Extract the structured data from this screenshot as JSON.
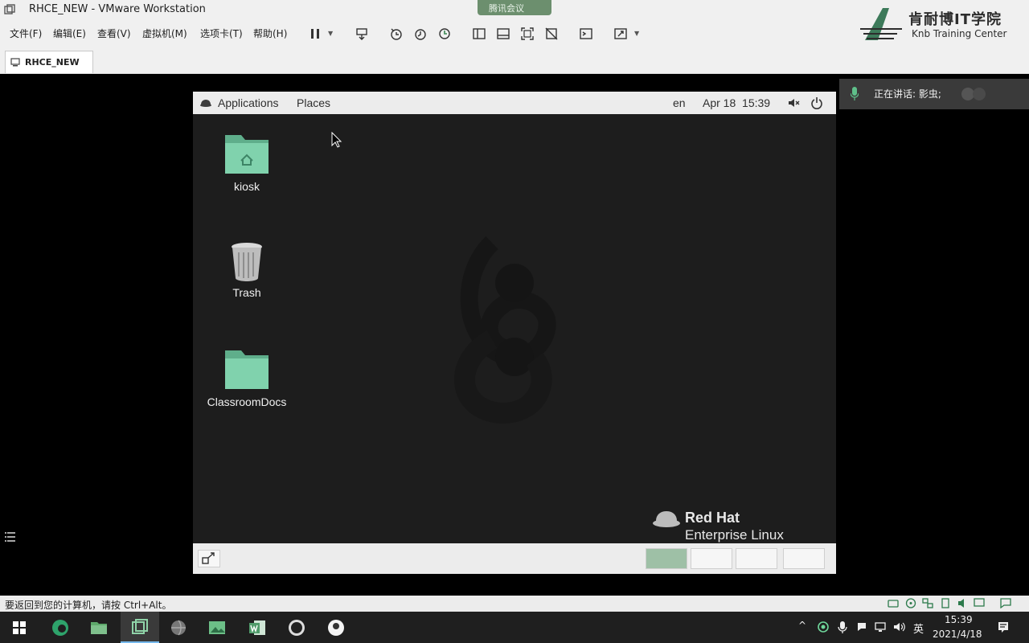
{
  "window": {
    "title": "RHCE_NEW - VMware Workstation"
  },
  "menu": {
    "items": [
      "文件(F)",
      "编辑(E)",
      "查看(V)",
      "虚拟机(M)",
      "选项卡(T)",
      "帮助(H)"
    ]
  },
  "tab": {
    "label": "RHCE_NEW"
  },
  "meeting": {
    "pill_label": "腾讯会议",
    "speaker_label": "正在讲话: 影虫;"
  },
  "watermark": {
    "title": "肯耐博IT学院",
    "subtitle": "Knb Training Center"
  },
  "guest": {
    "topbar": {
      "applications": "Applications",
      "places": "Places",
      "lang": "en",
      "datetime": "Apr 18  15:39"
    },
    "desktop_icons": [
      {
        "label": "kiosk",
        "icon": "home-folder-icon"
      },
      {
        "label": "Trash",
        "icon": "trash-icon"
      },
      {
        "label": "ClassroomDocs",
        "icon": "folder-icon"
      }
    ],
    "brand": {
      "line1": "Red Hat",
      "line2": "Enterprise Linux"
    },
    "workspaces": {
      "count": 4,
      "active_index": 0
    }
  },
  "statusbar": {
    "hint": "要返回到您的计算机，请按 Ctrl+Alt。"
  },
  "taskbar": {
    "ime": "英",
    "time": "15:39",
    "date": "2021/4/18"
  },
  "colors": {
    "folder": "#73c6a3",
    "workspace_active": "#9ec0a6",
    "taskbar": "#1f1f1f"
  }
}
